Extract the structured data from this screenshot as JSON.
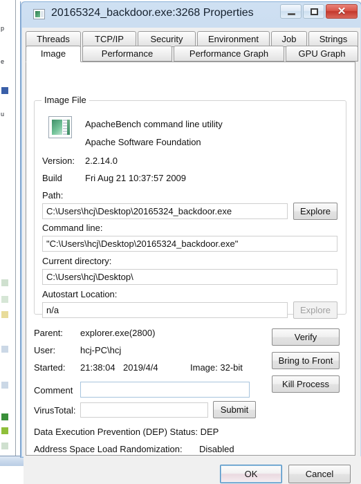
{
  "window": {
    "title": "20165324_backdoor.exe:3268 Properties",
    "icon": "application-window-icon",
    "buttons": {
      "minimize": "minimize-icon",
      "maximize": "maximize-icon",
      "close": "✕"
    }
  },
  "tabs": {
    "row1": [
      {
        "label": "Threads",
        "selected": false
      },
      {
        "label": "TCP/IP",
        "selected": false
      },
      {
        "label": "Security",
        "selected": false
      },
      {
        "label": "Environment",
        "selected": false
      },
      {
        "label": "Job",
        "selected": false
      },
      {
        "label": "Strings",
        "selected": false
      }
    ],
    "row2": [
      {
        "label": "Image",
        "selected": true
      },
      {
        "label": "Performance",
        "selected": false
      },
      {
        "label": "Performance Graph",
        "selected": false
      },
      {
        "label": "GPU Graph",
        "selected": false
      }
    ]
  },
  "image_file": {
    "legend": "Image File",
    "description": "ApacheBench command line utility",
    "company": "Apache Software Foundation",
    "version_label": "Version:",
    "version_value": "2.2.14.0",
    "build_label": "Build",
    "build_value": "Fri Aug 21 10:37:57 2009",
    "path_label": "Path:",
    "path_value": "C:\\Users\\hcj\\Desktop\\20165324_backdoor.exe",
    "path_explore_label": "Explore",
    "commandline_label": "Command line:",
    "commandline_value": "\"C:\\Users\\hcj\\Desktop\\20165324_backdoor.exe\"",
    "currentdir_label": "Current directory:",
    "currentdir_value": "C:\\Users\\hcj\\Desktop\\",
    "autostart_label": "Autostart Location:",
    "autostart_value": "n/a",
    "autostart_explore_label": "Explore"
  },
  "process": {
    "parent_label": "Parent:",
    "parent_value": "explorer.exe(2800)",
    "user_label": "User:",
    "user_value": "hcj-PC\\hcj",
    "started_label": "Started:",
    "started_time": "21:38:04",
    "started_date": "2019/4/4",
    "image_bits": "Image: 32-bit",
    "comment_label": "Comment",
    "comment_value": "",
    "virustotal_label": "VirusTotal:",
    "virustotal_value": "",
    "submit_label": "Submit",
    "dep_text": "Data Execution Prevention (DEP) Status: DEP",
    "aslr_label": "Address Space Load Randomization:",
    "aslr_value": "Disabled"
  },
  "side_buttons": {
    "verify": "Verify",
    "bring_to_front": "Bring to Front",
    "kill_process": "Kill Process"
  },
  "footer": {
    "ok": "OK",
    "cancel": "Cancel"
  },
  "colors": {
    "titlebar_glass": "#c6dbf0",
    "close_red": "#c3372c",
    "accent_blue": "#4b8ec2",
    "dialog_face": "#f0f0f0"
  }
}
